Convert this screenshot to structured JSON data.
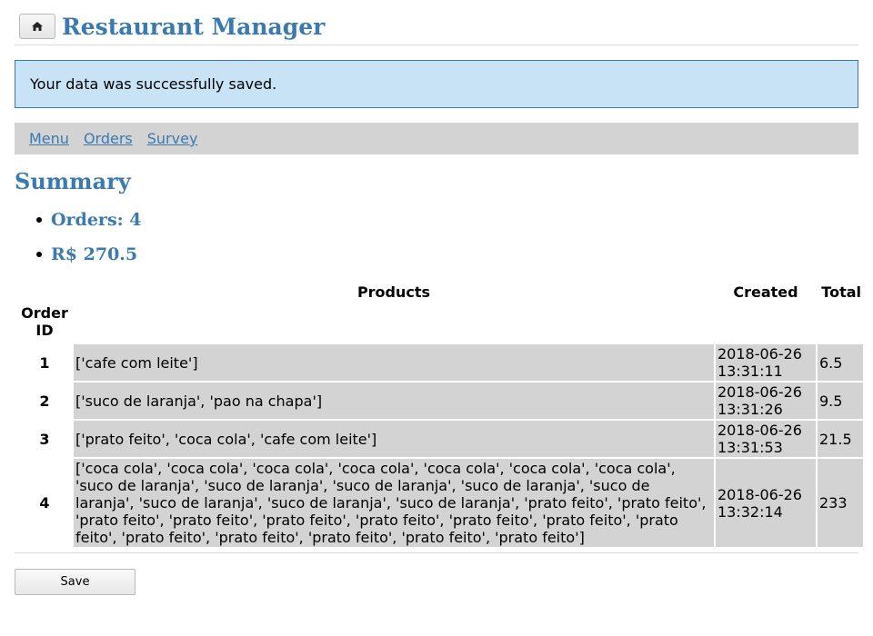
{
  "header": {
    "home_icon": "home-icon",
    "title": "Restaurant Manager"
  },
  "alert": {
    "message": "Your data was successfully saved."
  },
  "nav": {
    "items": [
      {
        "label": "Menu"
      },
      {
        "label": "Orders"
      },
      {
        "label": "Survey"
      }
    ]
  },
  "summary": {
    "title": "Summary",
    "orders_count": "Orders: 4",
    "revenue": "R$ 270.5"
  },
  "table": {
    "headers": {
      "order_id": "Order ID",
      "products": "Products",
      "created": "Created",
      "total": "Total"
    },
    "rows": [
      {
        "id": "1",
        "products": "['cafe com leite']",
        "created": "2018-06-26 13:31:11",
        "total": "6.5"
      },
      {
        "id": "2",
        "products": "['suco de laranja', 'pao na chapa']",
        "created": "2018-06-26 13:31:26",
        "total": "9.5"
      },
      {
        "id": "3",
        "products": "['prato feito', 'coca cola', 'cafe com leite']",
        "created": "2018-06-26 13:31:53",
        "total": "21.5"
      },
      {
        "id": "4",
        "products": "['coca cola', 'coca cola', 'coca cola', 'coca cola', 'coca cola', 'coca cola', 'coca cola', 'suco de laranja', 'suco de laranja', 'suco de laranja', 'suco de laranja', 'suco de laranja', 'suco de laranja', 'suco de laranja', 'suco de laranja', 'prato feito', 'prato feito', 'prato feito', 'prato feito', 'prato feito', 'prato feito', 'prato feito', 'prato feito', 'prato feito', 'prato feito', 'prato feito', 'prato feito', 'prato feito', 'prato feito']",
        "created": "2018-06-26 13:32:14",
        "total": "233"
      }
    ]
  },
  "save_button": {
    "label": "Save"
  },
  "colors": {
    "accent": "#3a7ab0",
    "alert_bg": "#c8e3f6",
    "nav_bg": "#d3d3d3",
    "cell_bg": "#d3d3d3"
  }
}
